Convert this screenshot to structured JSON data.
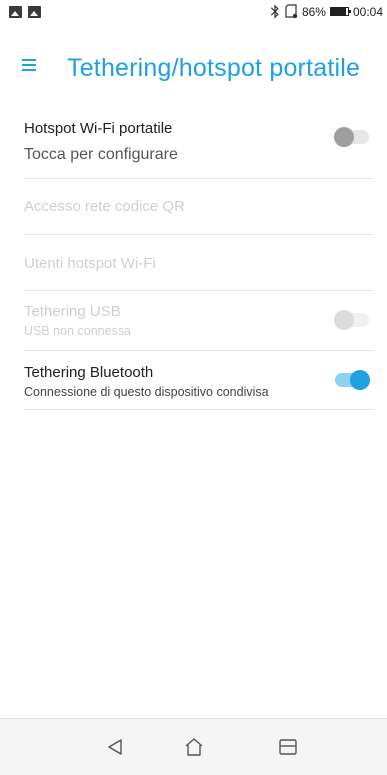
{
  "status_bar": {
    "battery_percent": "86%",
    "battery_level": 0.86,
    "time": "00:04",
    "icons": [
      "image-icon",
      "image-icon",
      "bluetooth-icon",
      "sd-card-icon",
      "battery-icon"
    ]
  },
  "header": {
    "title": "Tethering/hotspot portatile",
    "menu_icon": "menu-icon",
    "accent_color": "#1da1e3"
  },
  "items": [
    {
      "title": "Hotspot Wi-Fi portatile",
      "subtitle": "Tocca per configurare",
      "toggle": "off",
      "enabled": true
    },
    {
      "title": "Accesso rete codice QR",
      "enabled": false
    },
    {
      "title": "Utenti hotspot Wi-Fi",
      "enabled": false
    },
    {
      "title": "Tethering USB",
      "subtitle": "USB non connessa",
      "toggle": "off",
      "enabled": false
    },
    {
      "title": "Tethering Bluetooth",
      "subtitle": "Connessione di questo dispositivo condivisa",
      "toggle": "on",
      "enabled": true
    }
  ],
  "nav_bar": {
    "back": "back-icon",
    "home": "home-icon",
    "recents": "recents-icon"
  }
}
